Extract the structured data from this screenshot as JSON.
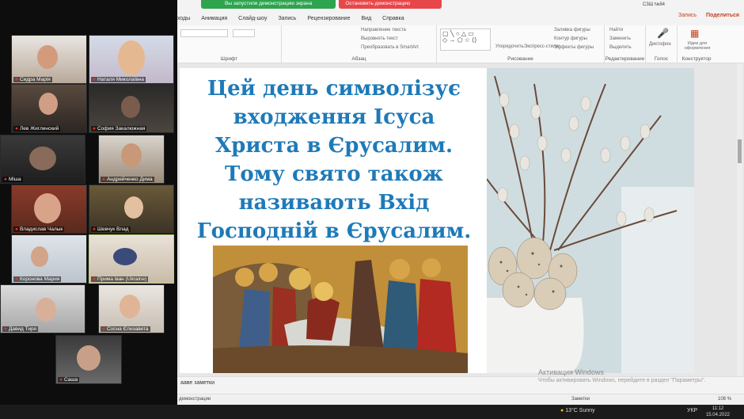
{
  "share": {
    "green_text": "Вы запустили демонстрацию экрана",
    "red_text": "Остановить демонстрацию"
  },
  "titlebar": {
    "user": "СЗШ №84"
  },
  "tabs": [
    "ходы",
    "Анимация",
    "Слайд-шоу",
    "Запись",
    "Рецензирование",
    "Вид",
    "Справка"
  ],
  "record_label": "Запись",
  "share_label": "Поделиться",
  "ribbon": {
    "font_group": "Шрифт",
    "paragraph_group": "Абзац",
    "drawing_group": "Рисование",
    "editing_group": "Редактирование",
    "voice_group": "Голос",
    "designer_group": "Конструктор",
    "text_direction": "Направление текста",
    "align_text": "Выровнять текст",
    "smartart": "Преобразовать в SmartArt",
    "arrange": "Упорядочить",
    "quick_styles": "Экспресс-стили",
    "shape_fill": "Заливка фигуры",
    "shape_outline": "Контур фигуры",
    "shape_effects": "Эффекты фигуры",
    "find": "Найти",
    "replace": "Заменить",
    "select": "Выделить",
    "dictate": "Диктофон",
    "design_ideas": "Идеи для оформления"
  },
  "slide": {
    "lines": [
      "Цей день символізує",
      "входження Ісуса",
      "Христа в Єрусалим.",
      "Тому свято також",
      "називають Вхід",
      "Господній в Єрусалим."
    ],
    "text_color": "#1e7ab8"
  },
  "notes_label": "ааве заметки",
  "watermark": {
    "line1": "Активация Windows",
    "line2": "Чтобы активировать Windows, перейдите в раздел \"Параметры\"."
  },
  "status": {
    "left": "демонстрации",
    "notes": "Заметки",
    "zoom": "108 %"
  },
  "taskbar": {
    "weather": "13°C  Sunny",
    "lang": "УКР",
    "time": "11:12",
    "date": "15.04.2022"
  },
  "participants": [
    {
      "name": "Сидра Марія"
    },
    {
      "name": "Наталя Миколаївна"
    },
    {
      "name": "Лев Жиглинский"
    },
    {
      "name": "София Закалюжная"
    },
    {
      "name": "Міша"
    },
    {
      "name": "Андрейченко Дима"
    },
    {
      "name": "Владислав Чалык"
    },
    {
      "name": "Шевчук Влад"
    },
    {
      "name": "Коронова Мария"
    },
    {
      "name": "Прима іван (Ukraine)"
    },
    {
      "name": "Давид Тиря"
    },
    {
      "name": "Сосна Єлизавета"
    },
    {
      "name": "Саша"
    }
  ]
}
